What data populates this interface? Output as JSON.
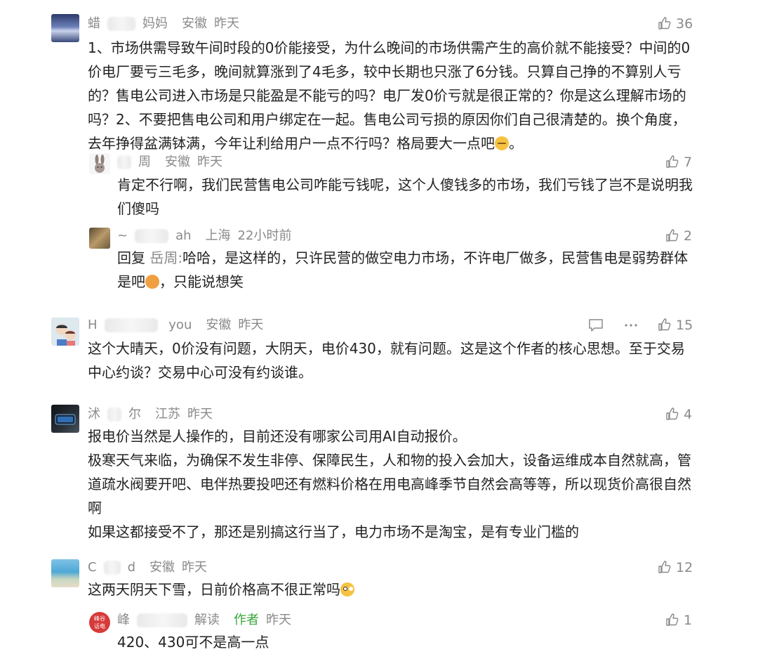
{
  "comments": [
    {
      "name": "蜡",
      "name_tail": "妈妈",
      "location": "安徽",
      "time": "昨天",
      "likes": "36",
      "text": "1、市场供需导致午间时段的0价能接受，为什么晚间的市场供需产生的高价就不能接受？中间的0价电厂要亏三毛多，晚间就算涨到了4毛多，较中长期也只涨了6分钱。只算自己挣的不算别人亏的？售电公司进入市场是只能盈是不能亏的吗？电厂发0价亏就是很正常的？你是这么理解市场的吗？2、不要把售电公司和用户绑定在一起。售电公司亏损的原因你们自己很清楚的。换个角度，去年挣得盆满钵满，今年让利给用户一点不行吗？格局要大一点吧",
      "text_end": "。"
    },
    {
      "name_tail": "周",
      "location": "安徽",
      "time": "昨天",
      "likes": "7",
      "text": "肯定不行啊，我们民营售电公司咋能亏钱呢，这个人傻钱多的市场，我们亏钱了岂不是说明我们傻吗"
    },
    {
      "name": "~",
      "name_tail": "ah",
      "location": "上海",
      "time": "22小时前",
      "likes": "2",
      "reply_prefix": "回复",
      "reply_to": "岳周:",
      "text": "哈哈，是这样的，只许民营的做空电力市场，不许电厂做多，民营售电是弱势群体是吧",
      "text_end": "，只能说想笑"
    },
    {
      "name": "H",
      "name_tail": "you",
      "location": "安徽",
      "time": "昨天",
      "likes": "15",
      "text": "这个大晴天，0价没有问题，大阴天，电价430，就有问题。这是这个作者的核心思想。至于交易中心约谈？交易中心可没有约谈谁。"
    },
    {
      "name": "沭",
      "name_tail": "尔",
      "location": "江苏",
      "time": "昨天",
      "likes": "4",
      "lines": [
        "报电价当然是人操作的，目前还没有哪家公司用AI自动报价。",
        "极寒天气来临，为确保不发生非停、保障民生，人和物的投入会加大，设备运维成本自然就高，管道疏水阀要开吧、电伴热要投吧还有燃料价格在用电高峰季节自然会高等等，所以现货价高很自然啊",
        "如果这都接受不了，那还是别搞这行当了，电力市场不是淘宝，是有专业门槛的"
      ]
    },
    {
      "name": "C",
      "name_tail": "d",
      "location": "安徽",
      "time": "昨天",
      "likes": "12",
      "text": "这两天阴天下雪，日前价格高不很正常吗"
    },
    {
      "name": "峰",
      "name_tail": "解读",
      "author_tag": "作者",
      "time": "昨天",
      "likes": "1",
      "avatar_text_top": "峰谷",
      "avatar_text_bottom": "话电",
      "text": "420、430可不是高一点"
    }
  ],
  "icons": {
    "like": "thumbs-up-icon",
    "comment": "comment-icon",
    "more": "more-icon"
  }
}
